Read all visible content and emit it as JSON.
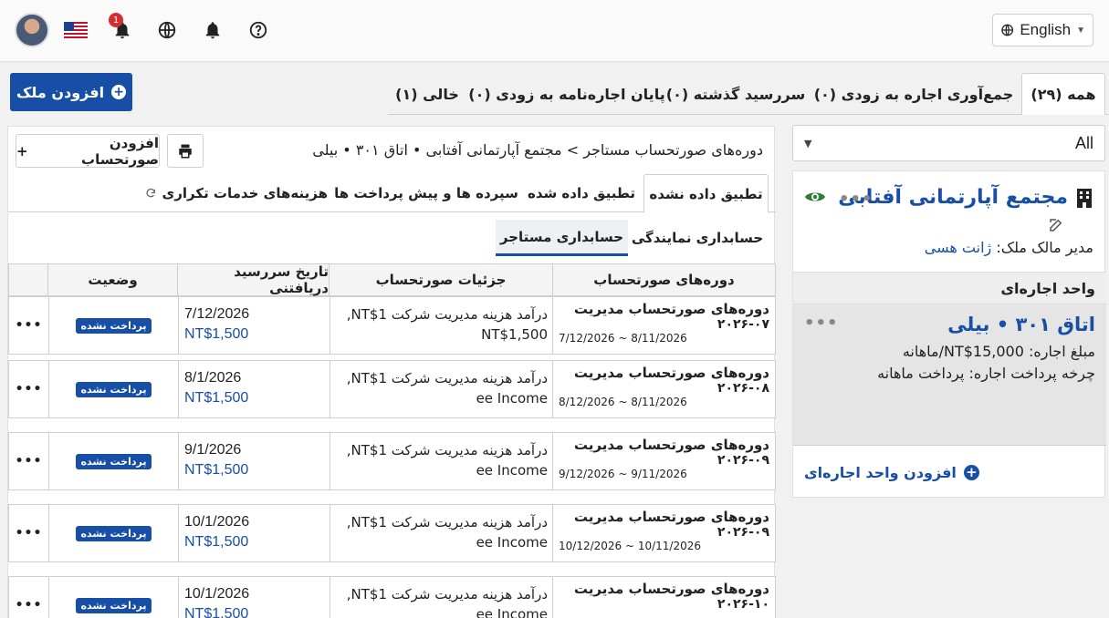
{
  "header": {
    "notification_count": "1",
    "language_label": "English"
  },
  "actions": {
    "add_property": "افزودن ملک",
    "add_voucher": "افزودن صورتحساب",
    "add_voucher_plus": "+"
  },
  "status_tabs": [
    {
      "label": "همه (۲۹)",
      "active": true
    },
    {
      "label": "جمع‌آوری اجاره به زودی (۰)"
    },
    {
      "label": "سررسید گذشته (۰)"
    },
    {
      "label": "پایان اجاره‌نامه به زودی (۰)"
    },
    {
      "label": "خالی (۱)"
    }
  ],
  "breadcrumb": "دوره‌های صورتحساب مستاجر > مجتمع آپارتمانی آفتابی  •  اتاق ۳۰۱ • بیلی",
  "sub_tabs": [
    {
      "label": "تطبیق داده نشده",
      "active": true
    },
    {
      "label": "تطبیق داده شده"
    },
    {
      "label": "سپرده ها و پیش پرداخت ها"
    },
    {
      "label": "هزینه‌های خدمات تکراری"
    }
  ],
  "accounting_tabs": [
    {
      "label": "حسابداری نمایندگی"
    },
    {
      "label": "حسابداری مستاجر",
      "active": true
    }
  ],
  "table": {
    "headers": {
      "period": "دوره‌های صورتحساب",
      "detail": "جزئیات صورتحساب",
      "due": "تاریخ سررسید دریافتنی",
      "status": "وضعیت"
    },
    "rows": [
      {
        "period_title": "دوره‌های صورتحساب مدیریت",
        "period_code": "۲۰۲۶-۰۷",
        "period_range": "7/12/2026 ~ 8/11/2026",
        "detail_1": "درآمد هزینه مدیریت شرکت  NT$1,",
        "detail_2": "NT$1,500",
        "due_date": "7/12/2026",
        "amount": "NT$1,500",
        "status": "پرداخت نشده",
        "more": "•••"
      },
      {
        "period_title": "دوره‌های صورتحساب مدیریت",
        "period_code": "۲۰۲۶-۰۸",
        "period_range": "8/12/2026 ~ 8/11/2026",
        "detail_1": "درآمد هزینه مدیریت شرکت  NT$1,",
        "detail_2": "ee Income",
        "due_date": "8/1/2026",
        "amount": "NT$1,500",
        "status": "پرداخت نشده",
        "more": "•••"
      },
      {
        "period_title": "دوره‌های صورتحساب مدیریت",
        "period_code": "۲۰۲۶-۰۹",
        "period_range": "9/12/2026 ~ 9/11/2026",
        "detail_1": "درآمد هزینه مدیریت شرکت  NT$1,",
        "detail_2": "ee Income",
        "due_date": "9/1/2026",
        "amount": "NT$1,500",
        "status": "پرداخت نشده",
        "more": "•••"
      },
      {
        "period_title": "دوره‌های صورتحساب مدیریت",
        "period_code": "۲۰۲۶-۰۹",
        "period_range": "10/12/2026 ~ 10/11/2026",
        "detail_1": "درآمد هزینه مدیریت شرکت  NT$1,",
        "detail_2": "ee Income",
        "due_date": "10/1/2026",
        "amount": "NT$1,500",
        "status": "پرداخت نشده",
        "more": "•••"
      },
      {
        "period_title": "دوره‌های صورتحساب مدیریت",
        "period_code": "۲۰۲۶-۱۰",
        "period_range": "",
        "detail_1": "درآمد هزینه مدیریت شرکت  NT$1,",
        "detail_2": "ee Income",
        "due_date": "10/1/2026",
        "amount": "NT$1,500",
        "status": "پرداخت نشده",
        "more": "•••"
      }
    ]
  },
  "filter": {
    "value": "All"
  },
  "property": {
    "name": "مجتمع آپارتمانی آفتابی",
    "manager_label": "مدیر مالک ملک:",
    "manager_name": "ژانت هسی",
    "unit_section": "واحد اجاره‌ای",
    "unit_name": "اتاق ۳۰۱ • بیلی",
    "rent": "مبلغ اجاره: NT$15,000/ماهانه",
    "cycle": "چرخه پرداخت اجاره: پرداخت ماهانه",
    "add_unit": "افزودن واحد اجاره‌ای"
  },
  "colors": {
    "accent": "#174ea6",
    "badge": "#d32f2f",
    "eye": "#2e7d32"
  }
}
